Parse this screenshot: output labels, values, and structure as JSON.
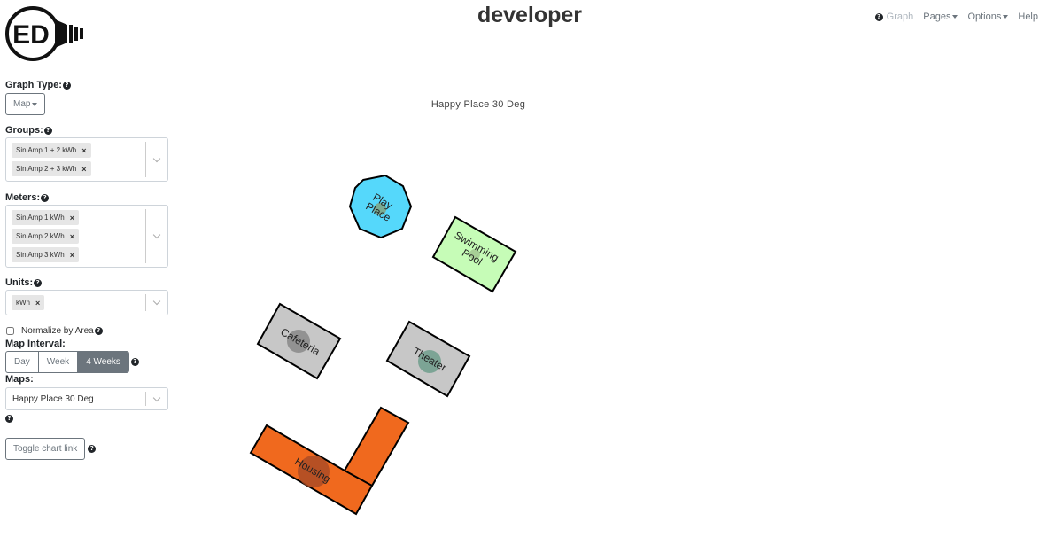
{
  "app": {
    "logo_text": "ED",
    "title": "developer"
  },
  "nav": {
    "graph": "Graph",
    "pages": "Pages",
    "options": "Options",
    "help": "Help"
  },
  "sidebar": {
    "graph_type_label": "Graph Type:",
    "graph_type_value": "Map",
    "groups_label": "Groups:",
    "groups": [
      "Sin Amp 1 + 2 kWh",
      "Sin Amp 2 + 3 kWh"
    ],
    "meters_label": "Meters:",
    "meters": [
      "Sin Amp 1 kWh",
      "Sin Amp 2 kWh",
      "Sin Amp 3 kWh"
    ],
    "units_label": "Units:",
    "units": [
      "kWh"
    ],
    "normalize_label": "Normalize by Area",
    "normalize_checked": false,
    "map_interval_label": "Map Interval:",
    "intervals": [
      "Day",
      "Week",
      "4 Weeks"
    ],
    "active_interval": "4 Weeks",
    "maps_label": "Maps:",
    "maps_value": "Happy Place 30 Deg",
    "toggle_chart_link": "Toggle chart link"
  },
  "map": {
    "title": "Happy Place 30 Deg",
    "buildings": [
      {
        "name_lines": [
          "Play",
          "Place"
        ],
        "color": "#55d8fb"
      },
      {
        "name_lines": [
          "Swimming",
          "Pool"
        ],
        "color": "#c6fcb7"
      },
      {
        "name_lines": [
          "Cafeteria"
        ],
        "color": "#c7c7c7"
      },
      {
        "name_lines": [
          "Theater"
        ],
        "color": "#c7c7c7"
      },
      {
        "name_lines": [
          "Housing"
        ],
        "color": "#f0691e"
      }
    ]
  }
}
